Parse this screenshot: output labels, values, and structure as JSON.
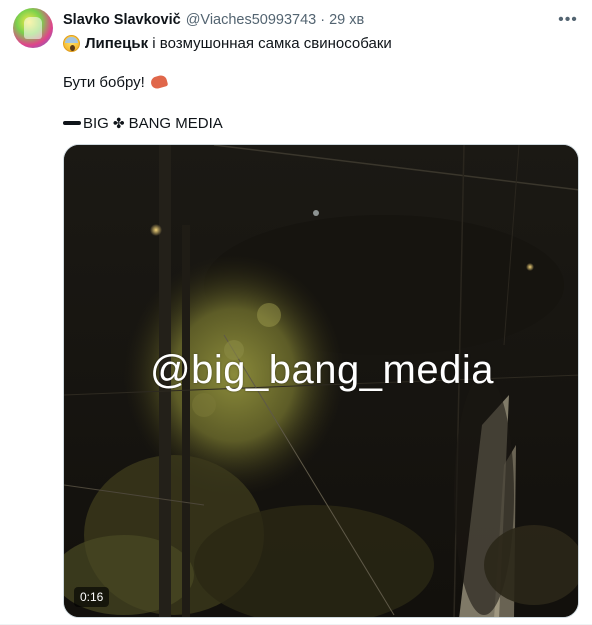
{
  "tweet": {
    "author_name": "Slavko Slavkovič",
    "author_handle": "@Viaches50993743",
    "separator": "·",
    "timestamp": "29 хв",
    "more_icon": "more-dots-icon",
    "line1_emoji": "screaming-face-emoji",
    "line1_bold": "Липецьк",
    "line1_rest": " і возмушонная самка свинособаки",
    "line2_text": "Бути бобру!",
    "line2_emoji": "shrimp-emoji",
    "line3_before": "BIG",
    "line3_symbol": "✤",
    "line3_after": "BANG MEDIA"
  },
  "media": {
    "watermark": "@big_bang_media",
    "duration": "0:16"
  },
  "colors": {
    "text": "#0f1419",
    "secondary": "#536471",
    "media_bg": "#17130f"
  }
}
